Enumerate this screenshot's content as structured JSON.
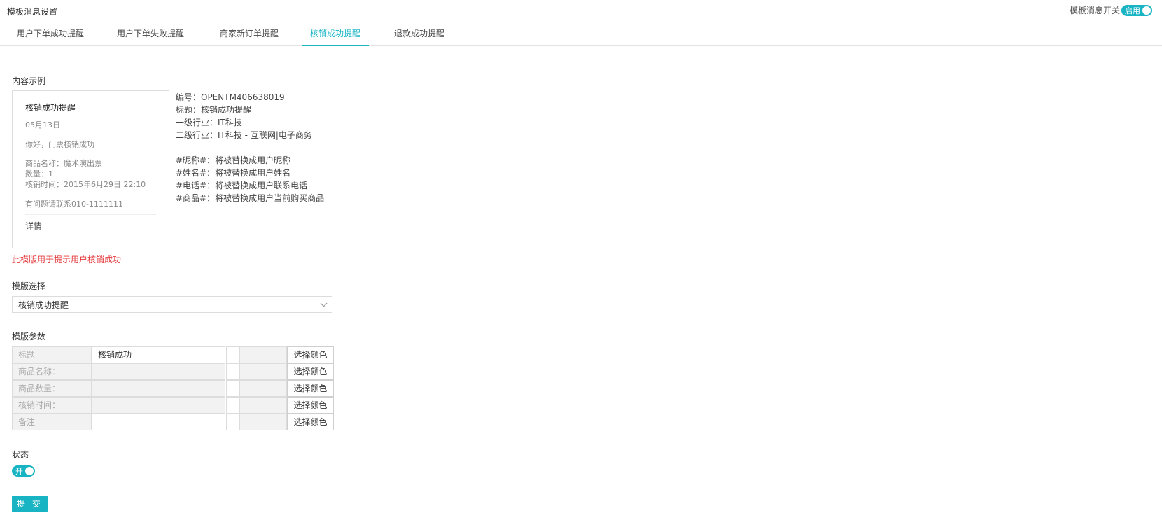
{
  "page_title": "模板消息设置",
  "global_switch": {
    "label": "模板消息开关",
    "state": "启用",
    "on": true
  },
  "tabs": [
    {
      "label": "用户下单成功提醒",
      "active": false
    },
    {
      "label": "用户下单失败提醒",
      "active": false
    },
    {
      "label": "商家新订单提醒",
      "active": false
    },
    {
      "label": "核销成功提醒",
      "active": true
    },
    {
      "label": "退款成功提醒",
      "active": false
    }
  ],
  "example": {
    "section_label": "内容示例",
    "card": {
      "title": "核销成功提醒",
      "date": "05月13日",
      "greeting": "你好，门票核销成功",
      "lines": [
        "商品名称：魔术演出票",
        "数量：1",
        "核销时间：2015年6月29日 22:10"
      ],
      "contact": "有问题请联系010-1111111",
      "detail": "详情"
    },
    "info": {
      "number": "编号：OPENTM406638019",
      "title": "标题：核销成功提醒",
      "industry1": "一级行业：IT科技",
      "industry2": "二级行业：IT科技 - 互联网|电子商务",
      "vars": [
        "#昵称#：将被替换成用户昵称",
        "#姓名#：将被替换成用户姓名",
        "#电话#：将被替换成用户联系电话",
        "#商品#：将被替换成用户当前购买商品"
      ]
    },
    "hint": "此模版用于提示用户核销成功"
  },
  "template_select": {
    "label": "模版选择",
    "value": "核销成功提醒"
  },
  "params": {
    "label": "模版参数",
    "rows": [
      {
        "name": "标题",
        "value": "核销成功",
        "editable": true,
        "button": "选择颜色"
      },
      {
        "name": "商品名称：",
        "value": "",
        "editable": false,
        "button": "选择颜色"
      },
      {
        "name": "商品数量：",
        "value": "",
        "editable": false,
        "button": "选择颜色"
      },
      {
        "name": "核销时间：",
        "value": "",
        "editable": false,
        "button": "选择颜色"
      },
      {
        "name": "备注",
        "value": "",
        "editable": true,
        "button": "选择颜色"
      }
    ]
  },
  "status": {
    "label": "状态",
    "state": "开",
    "on": true
  },
  "submit_label": "提 交",
  "colors": {
    "accent": "#19b4c3",
    "hint": "#e4393c"
  }
}
